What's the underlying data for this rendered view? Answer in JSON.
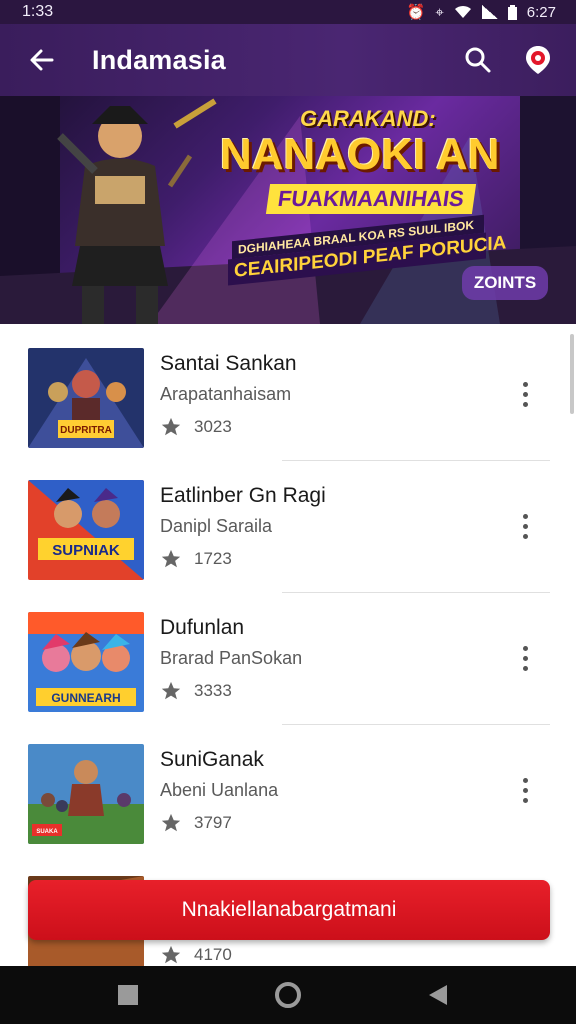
{
  "status_bar": {
    "time": "1:33",
    "clock": "6:27",
    "icons": [
      "alarm-icon",
      "location-icon",
      "wifi-icon",
      "signal-icon",
      "battery-icon"
    ]
  },
  "app_bar": {
    "title": "Indamasia",
    "icons": [
      "back-arrow-icon",
      "search-icon",
      "notification-icon"
    ]
  },
  "banner": {
    "line1": "GARAKAND:",
    "line2": "NANAOKI AN",
    "line3": "FUAKMAANIHAIS",
    "line4": "DGHIAHEAA BRAAL KOA RS SUUL IBOK",
    "line5": "CEAIRIPEODI PEAF PORUCIA",
    "points_label": "ZOINTS"
  },
  "list": {
    "items": [
      {
        "title": "Santai Sankan",
        "subtitle": "Arapatanhaisam",
        "rating": "3023",
        "thumb_text": "DUPRITRA"
      },
      {
        "title": "Eatlinber Gn Ragi",
        "subtitle": "Danipl Saraila",
        "rating": "1723",
        "thumb_text": "SUPNIAK"
      },
      {
        "title": "Dufunlan",
        "subtitle": "Brarad PanSokan",
        "rating": "3333",
        "thumb_text": "GUNNEARH"
      },
      {
        "title": "SuniGanak",
        "subtitle": "Abeni Uanlana",
        "rating": "3797",
        "thumb_text": "SUAKA"
      },
      {
        "title": "",
        "subtitle": "",
        "rating": "4170",
        "thumb_text": ""
      }
    ]
  },
  "cta": {
    "label": "Nnakiellanabargatmani"
  },
  "colors": {
    "app_bar": "#3a1d5c",
    "status_bar": "#2b1640",
    "cta": "#e01c26",
    "nav_bar": "#0c0c0c"
  },
  "nav": {
    "icons": [
      "recents-icon",
      "home-icon",
      "back-icon"
    ]
  }
}
